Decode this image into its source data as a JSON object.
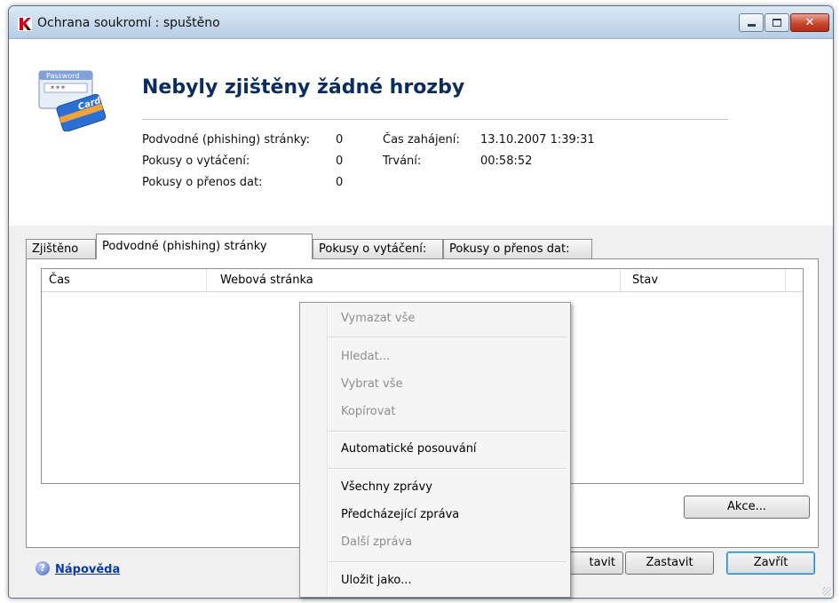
{
  "window": {
    "title": "Ochrana soukromí : spuštěno",
    "close_glyph": "✕"
  },
  "header": {
    "status_title": "Nebyly zjištěny žádné hrozby",
    "stats": {
      "phishing_label": "Podvodné (phishing) stránky:",
      "phishing_value": "0",
      "dial_label": "Pokusy o vytáčení:",
      "dial_value": "0",
      "transfer_label": "Pokusy o přenos dat:",
      "transfer_value": "0",
      "start_label": "Čas zahájení:",
      "start_value": "13.10.2007 1:39:31",
      "duration_label": "Trvání:",
      "duration_value": "00:58:52"
    },
    "art": {
      "line1": "Password",
      "line2": "***",
      "line3": "Card"
    }
  },
  "tabs": [
    "Zjištěno",
    "Podvodné (phishing) stránky",
    "Pokusy o vytáčení:",
    "Pokusy o přenos dat:"
  ],
  "active_tab": 1,
  "table": {
    "columns": [
      "Čas",
      "Webová stránka",
      "Stav"
    ]
  },
  "buttons": {
    "actions": "Akce...",
    "resume_partial": "tavit",
    "stop": "Zastavit",
    "close": "Zavřít"
  },
  "help": {
    "label": "Nápověda",
    "icon": "help-icon"
  },
  "context_menu": {
    "clear_all": "Vymazat vše",
    "find": "Hledat...",
    "select_all": "Vybrat vše",
    "copy": "Kopírovat",
    "auto_scroll": "Automatické posouvání",
    "all_messages": "Všechny zprávy",
    "previous_message": "Předcházející zpráva",
    "next_message": "Další zpráva",
    "save_as": "Uložit jako..."
  },
  "colors": {
    "title_text": "#0a2d5e",
    "link": "#0b3aa8",
    "close_button": "#c7472e",
    "disabled_text": "#8d8d8d"
  }
}
